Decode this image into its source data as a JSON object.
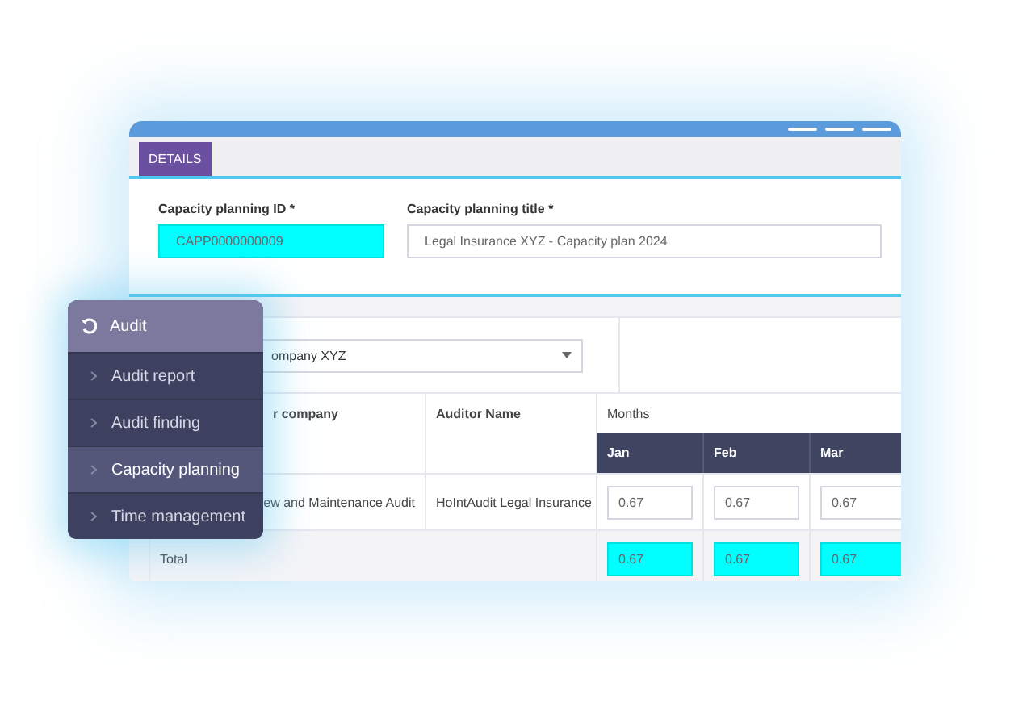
{
  "tab": {
    "label": "DETAILS",
    "selected": true
  },
  "form": {
    "fields": [
      {
        "label": "Capacity planning ID *",
        "value": "CAPP0000000009",
        "highlighted": true
      },
      {
        "label": "Capacity planning title *",
        "value": "Legal Insurance XYZ - Capacity plan 2024",
        "highlighted": false
      }
    ]
  },
  "table": {
    "company_select": {
      "value": "ompany XYZ"
    },
    "columns": [
      "r company",
      "Auditor Name",
      "Months"
    ],
    "months": [
      "Jan",
      "Feb",
      "Mar"
    ],
    "rows": [
      {
        "kind": "data",
        "cells": [
          "ew and Maintenance Audit",
          "HoIntAudit Legal Insurance"
        ],
        "values": [
          {
            "value": "0.67",
            "highlighted": false
          },
          {
            "value": "0.67",
            "highlighted": false
          },
          {
            "value": "0.67",
            "highlighted": false
          }
        ]
      },
      {
        "kind": "total",
        "cells": [
          "Total"
        ],
        "values": [
          {
            "value": "0.67",
            "highlighted": true
          },
          {
            "value": "0.67",
            "highlighted": true
          },
          {
            "value": "0.67",
            "highlighted": true
          }
        ]
      }
    ]
  },
  "menu": {
    "title": "Audit",
    "items": [
      {
        "label": "Audit report",
        "selected": false
      },
      {
        "label": "Audit finding",
        "selected": false
      },
      {
        "label": "Capacity planning",
        "selected": true
      },
      {
        "label": "Time management",
        "selected": false
      }
    ]
  }
}
